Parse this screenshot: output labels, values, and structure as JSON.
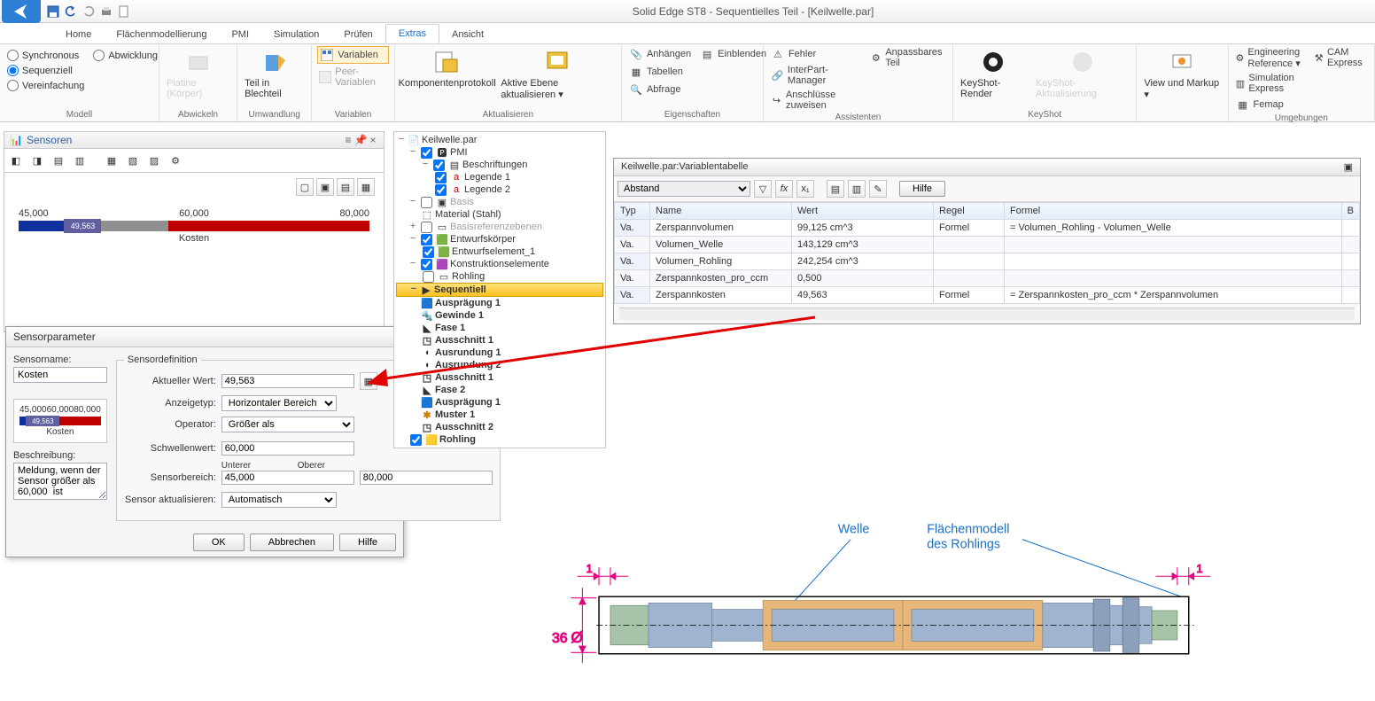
{
  "title": "Solid Edge ST8 - Sequentielles Teil - [Keilwelle.par]",
  "ribbon_tabs": [
    "Home",
    "Flächenmodellierung",
    "PMI",
    "Simulation",
    "Prüfen",
    "Extras",
    "Ansicht"
  ],
  "ribbon_active": 5,
  "ribbon": {
    "model": {
      "label": "Modell",
      "synchronous": "Synchronous",
      "sequenziell": "Sequenziell",
      "vereinfachung": "Vereinfachung",
      "abwicklung": "Abwicklung"
    },
    "abwickeln": {
      "label": "Abwickeln",
      "platine": "Platine (Körper)"
    },
    "umwandlung": {
      "label": "Umwandlung",
      "teilin": "Teil in Blechteil"
    },
    "variablen": {
      "label": "Variablen",
      "variablen": "Variablen",
      "peer": "Peer-Variablen"
    },
    "aktualisieren": {
      "label": "Aktualisieren",
      "komp": "Komponentenprotokoll",
      "aktive": "Aktive Ebene aktualisieren ▾"
    },
    "eigenschaften": {
      "label": "Eigenschaften",
      "anhaengen": "Anhängen",
      "einblenden": "Einblenden",
      "tabellen": "Tabellen",
      "abfrage": "Abfrage"
    },
    "assistenten": {
      "label": "Assistenten",
      "fehler": "Fehler",
      "anpassbares": "Anpassbares Teil",
      "interpart": "InterPart-Manager",
      "anschluesse": "Anschlüsse zuweisen"
    },
    "keyshot": {
      "label": "KeyShot",
      "render": "KeyShot-Render",
      "aktual": "KeyShot-Aktualisierung"
    },
    "viewmarkup": {
      "label": "",
      "btn": "View und Markup ▾"
    },
    "umgebungen": {
      "label": "Umgebungen",
      "engref": "Engineering Reference ▾",
      "cam": "CAM Express",
      "simexp": "Simulation Express",
      "femap": "Femap"
    }
  },
  "sensor_panel": {
    "title": "Sensoren",
    "range": {
      "lo": "45,000",
      "mid": "60,000",
      "hi": "80,000"
    },
    "value": "49,563",
    "axis_label": "Kosten"
  },
  "sensor_dialog": {
    "title": "Sensorparameter",
    "sensorname_label": "Sensorname:",
    "sensorname": "Kosten",
    "beschreibung_label": "Beschreibung:",
    "beschreibung": "Meldung, wenn der Sensor größer als 60,000  ist",
    "def_legend": "Sensordefinition",
    "aktueller_wert_label": "Aktueller Wert:",
    "aktueller_wert": "49,563",
    "anzeigetyp_label": "Anzeigetyp:",
    "anzeigetyp": "Horizontaler Bereich",
    "operator_label": "Operator:",
    "operator": "Größer als",
    "schwellenwert_label": "Schwellenwert:",
    "schwellenwert": "60,000",
    "sensorbereich_label": "Sensorbereich:",
    "unterer_label": "Unterer",
    "oberer_label": "Oberer",
    "unterer": "45,000",
    "oberer": "80,000",
    "sensor_akt_label": "Sensor aktualisieren:",
    "sensor_akt": "Automatisch",
    "btn_ok": "OK",
    "btn_cancel": "Abbrechen",
    "btn_help": "Hilfe",
    "mini_range": {
      "lo": "45,000",
      "mid": "60,000",
      "hi": "80,000"
    },
    "mini_value": "49,563",
    "mini_label": "Kosten"
  },
  "tree": {
    "root": "Keilwelle.par",
    "pmi": "PMI",
    "beschriftungen": "Beschriftungen",
    "legende1": "Legende 1",
    "legende2": "Legende 2",
    "basis": "Basis",
    "material": "Material (Stahl)",
    "basisref": "Basisreferenzebenen",
    "entwurfskoerper": "Entwurfskörper",
    "entwurfselement1": "Entwurfselement_1",
    "konstruktionselemente": "Konstruktionselemente",
    "rohling_node": "Rohling",
    "sequentiell": "Sequentiell",
    "items": [
      "Ausprägung 1",
      "Gewinde 1",
      "Fase 1",
      "Ausschnitt 1",
      "Ausrundung 1",
      "Ausrundung 2",
      "Ausschnitt 1",
      "Fase 2",
      "Ausprägung 1",
      "Muster 1",
      "Ausschnitt 2",
      "Rohling"
    ]
  },
  "var_window": {
    "title": "Keilwelle.par:Variablentabelle",
    "filter": "Abstand",
    "headers": [
      "Typ",
      "Name",
      "Wert",
      "Regel",
      "Formel",
      "B"
    ],
    "rows": [
      {
        "typ": "Va.",
        "name": "Zerspannvolumen",
        "wert": "99,125 cm^3",
        "regel": "Formel",
        "formel": "= Volumen_Rohling - Volumen_Welle"
      },
      {
        "typ": "Va.",
        "name": "Volumen_Welle",
        "wert": "143,129 cm^3",
        "regel": "",
        "formel": ""
      },
      {
        "typ": "Va.",
        "name": "Volumen_Rohling",
        "wert": "242,254 cm^3",
        "regel": "",
        "formel": ""
      },
      {
        "typ": "Va.",
        "name": "Zerspannkosten_pro_ccm",
        "wert": "0,500",
        "regel": "",
        "formel": ""
      },
      {
        "typ": "Va.",
        "name": "Zerspannkosten",
        "wert": "49,563",
        "regel": "Formel",
        "formel": "= Zerspannkosten_pro_ccm * Zerspannvolumen"
      }
    ],
    "hilfe": "Hilfe"
  },
  "viewport": {
    "welle": "Welle",
    "flaechenmodell1": "Flächenmodell",
    "flaechenmodell2": "des Rohlings",
    "dim36": "36",
    "diameter": "Ø",
    "dim1": "1"
  }
}
